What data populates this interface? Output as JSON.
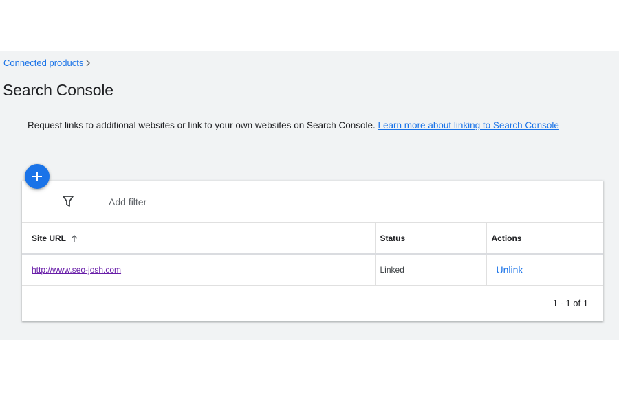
{
  "breadcrumb": {
    "parent_label": "Connected products"
  },
  "page": {
    "title": "Search Console",
    "description_text": "Request links to additional websites or link to your own websites on Search Console. ",
    "learn_more_label": "Learn more about linking to Search Console"
  },
  "filter": {
    "placeholder": "Add filter"
  },
  "table": {
    "columns": {
      "site_url": "Site URL",
      "status": "Status",
      "actions": "Actions"
    },
    "rows": [
      {
        "site_url": "http://www.seo-josh.com",
        "status": "Linked",
        "action_label": "Unlink"
      }
    ]
  },
  "pagination": {
    "range_text": "1 - 1 of 1"
  },
  "icons": {
    "add": "plus-icon",
    "filter": "filter-icon",
    "sort": "arrow-up-icon",
    "breadcrumb_separator": "chevron-right-icon"
  },
  "colors": {
    "accent": "#1a73e8",
    "visited_link": "#681da8",
    "panel_background": "#f1f3f4"
  }
}
